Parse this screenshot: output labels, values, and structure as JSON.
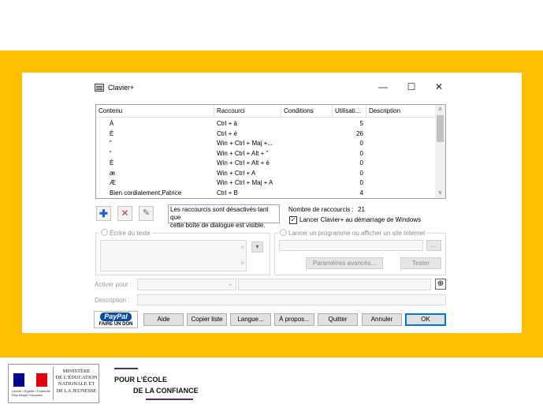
{
  "window": {
    "title": "Clavier+",
    "minimize_glyph": "—",
    "maximize_glyph": "☐",
    "close_glyph": "✕",
    "app_icon": "keyboard-icon"
  },
  "list": {
    "columns": [
      "Contenu",
      "Raccourci",
      "Conditions",
      "Utilisati...",
      "Description"
    ],
    "rows": [
      {
        "content": "À",
        "shortcut": "Ctrl + à",
        "conditions": "",
        "usage": "5",
        "description": ""
      },
      {
        "content": "É",
        "shortcut": "Ctrl + é",
        "conditions": "",
        "usage": "26",
        "description": ""
      },
      {
        "content": "”",
        "shortcut": "Win + Ctrl + Maj +...",
        "conditions": "",
        "usage": "0",
        "description": ""
      },
      {
        "content": "“",
        "shortcut": "Win + Ctrl + Alt + ”",
        "conditions": "",
        "usage": "0",
        "description": ""
      },
      {
        "content": "È",
        "shortcut": "Win + Ctrl + Alt + è",
        "conditions": "",
        "usage": "0",
        "description": ""
      },
      {
        "content": "æ",
        "shortcut": "Win + Ctrl + A",
        "conditions": "",
        "usage": "0",
        "description": ""
      },
      {
        "content": "Æ",
        "shortcut": "Win + Ctrl + Maj + A",
        "conditions": "",
        "usage": "0",
        "description": ""
      },
      {
        "content": "Bien cordialement,Patrice",
        "shortcut": "Ctrl + B",
        "conditions": "",
        "usage": "4",
        "description": ""
      }
    ],
    "scroll_up_glyph": "˄",
    "scroll_down_glyph": "˅"
  },
  "tools": {
    "add_glyph": "✚",
    "delete_glyph": "✕",
    "edit_glyph": "✎",
    "colors": {
      "add": "#1a5fd1",
      "delete": "#d23b3b",
      "edit": "#6a6a6a"
    }
  },
  "info": {
    "disabled_notice_line1": "Les raccourcis sont désactivés tant que",
    "disabled_notice_line2": "cette boîte de dialogue est visible.",
    "count_label": "Nombre de raccourcis :",
    "count_value": "21",
    "startup_label": "Lancer Clavier+ au démarrage de Windows",
    "startup_checked": true,
    "check_glyph": "✓"
  },
  "write_text": {
    "label": "Écrire du texte",
    "up_glyph": "˄",
    "down_glyph": "˅",
    "dropdown_glyph": "▾"
  },
  "launch": {
    "label": "Lancer un programme ou afficher un site Internet",
    "browse_label": "...",
    "advanced_label": "Paramètres avancés...",
    "test_label": "Tester"
  },
  "activate": {
    "label": "Activer pour :",
    "dropdown_glyph": "⌄",
    "target_glyph": "⊕"
  },
  "description": {
    "label": "Description :"
  },
  "buttons": {
    "paypal_logo": "PayPal",
    "paypal_sub": "FAIRE UN DON",
    "help": "Aide",
    "copy_list": "Copier liste",
    "language": "Langue...",
    "about": "À propos...",
    "quit": "Quitter",
    "cancel": "Annuler",
    "ok": "OK"
  },
  "footer": {
    "ministry_line1": "MINISTÈRE",
    "ministry_line2": "DE L’ÉDUCATION",
    "ministry_line3": "NATIONALE ET",
    "ministry_line4": "DE LA JEUNESSE",
    "rf_line1": "Liberté • Égalité • Fraternité",
    "rf_line2": "République Française",
    "confiance_line1": "POUR L’ÉCOLE",
    "confiance_line2": "DE LA CONFIANCE"
  },
  "colors": {
    "band": "#ffc000",
    "focus": "#0078d7"
  }
}
